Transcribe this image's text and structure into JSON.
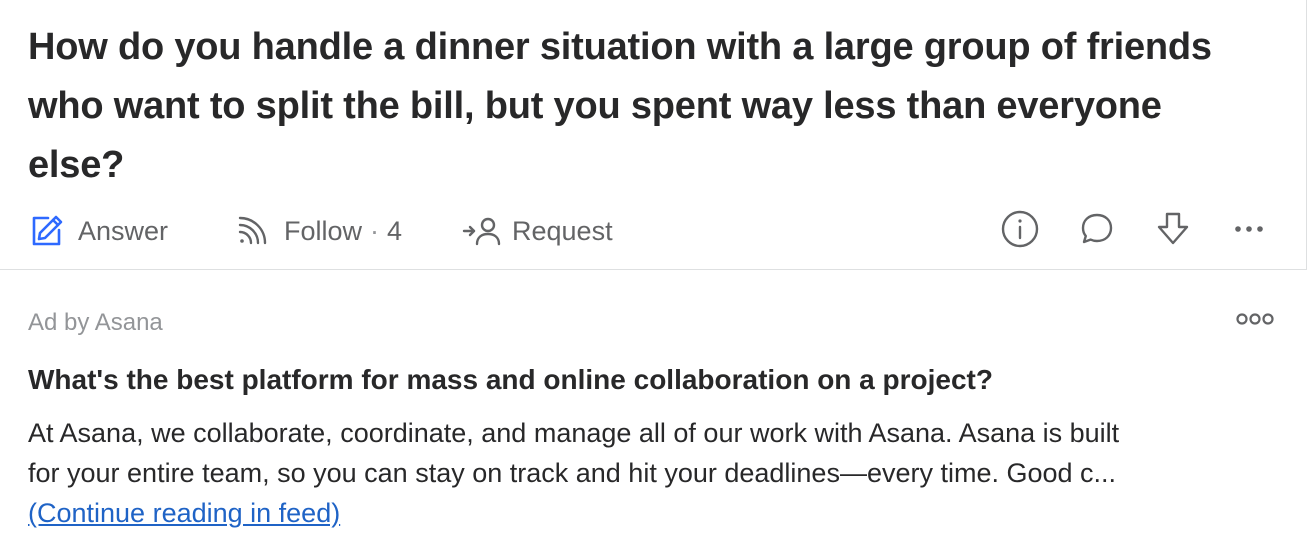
{
  "question": {
    "title": "How do you handle a dinner situation with a large group of friends who want to split the bill, but you spent way less than everyone else?",
    "actions": {
      "answer_label": "Answer",
      "follow_label": "Follow",
      "follow_separator": "·",
      "follow_count": "4",
      "request_label": "Request"
    },
    "icons": {
      "answer": "pencil-edit-icon",
      "follow": "rss-follow-icon",
      "request": "request-person-icon",
      "info": "info-circle-icon",
      "comment": "comment-bubble-icon",
      "downvote": "downvote-arrow-icon",
      "more": "more-dots-icon"
    },
    "accent_color": "#2e69ff"
  },
  "ad": {
    "label": "Ad by Asana",
    "title": "What's the best platform for mass and online collaboration on a project?",
    "body_line1": "At Asana, we collaborate, coordinate, and manage all of our work with Asana. Asana is built",
    "body_line2": "for your entire team, so you can stay on track and hit your deadlines—every time. Good c...",
    "continue_link": "(Continue reading in feed)",
    "more_icon": "more-options-icon"
  }
}
